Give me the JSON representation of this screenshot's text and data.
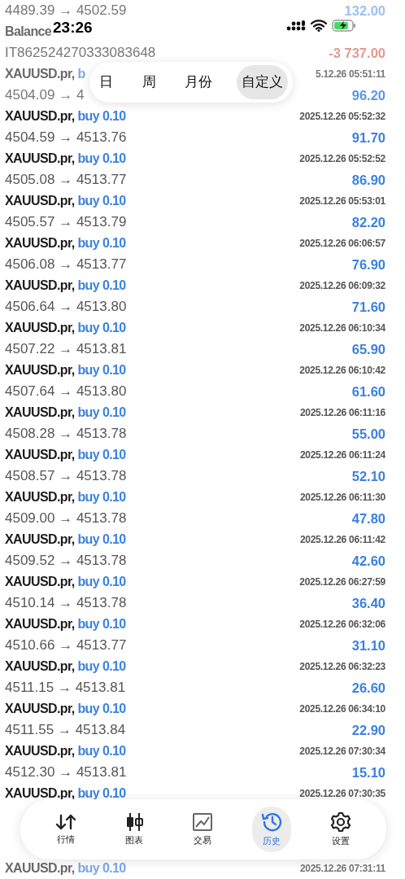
{
  "status_bar": {
    "time": "23:26"
  },
  "period_tabs": [
    {
      "label": "日",
      "selected": false
    },
    {
      "label": "周",
      "selected": false
    },
    {
      "label": "月份",
      "selected": false
    },
    {
      "label": "自定义",
      "selected": true
    }
  ],
  "deals": [
    {
      "faded": true,
      "price": "4489.39 → 4502.59",
      "profit": "132.00",
      "color": "#9dbff0"
    },
    {
      "faded": true,
      "symbol": "Balance",
      "comment": "IT862524270333083648",
      "profit": "-3 737.00",
      "color": "#e39a8c"
    },
    {
      "faded": true,
      "symbol": "XAUUSD.pr, ",
      "side": "b",
      "time": "5.12.26 05:51:11",
      "price": "4504.09 → 4",
      "profit": "96.20",
      "color": "#5b95e6"
    },
    {
      "faded": false,
      "symbol": "XAUUSD.pr, ",
      "side": "buy 0.10",
      "time": "2025.12.26 05:52:32",
      "price": "4504.59 → 4513.76",
      "profit": "91.70",
      "color": "#3a80e0"
    },
    {
      "faded": false,
      "symbol": "XAUUSD.pr, ",
      "side": "buy 0.10",
      "time": "2025.12.26 05:52:52",
      "price": "4505.08 → 4513.77",
      "profit": "86.90",
      "color": "#3a80e0"
    },
    {
      "faded": false,
      "symbol": "XAUUSD.pr, ",
      "side": "buy 0.10",
      "time": "2025.12.26 05:53:01",
      "price": "4505.57 → 4513.79",
      "profit": "82.20",
      "color": "#3a80e0"
    },
    {
      "faded": false,
      "symbol": "XAUUSD.pr, ",
      "side": "buy 0.10",
      "time": "2025.12.26 06:06:57",
      "price": "4506.08 → 4513.77",
      "profit": "76.90",
      "color": "#3a80e0"
    },
    {
      "faded": false,
      "symbol": "XAUUSD.pr, ",
      "side": "buy 0.10",
      "time": "2025.12.26 06:09:32",
      "price": "4506.64 → 4513.80",
      "profit": "71.60",
      "color": "#3a80e0"
    },
    {
      "faded": false,
      "symbol": "XAUUSD.pr, ",
      "side": "buy 0.10",
      "time": "2025.12.26 06:10:34",
      "price": "4507.22 → 4513.81",
      "profit": "65.90",
      "color": "#3a80e0"
    },
    {
      "faded": false,
      "symbol": "XAUUSD.pr, ",
      "side": "buy 0.10",
      "time": "2025.12.26 06:10:42",
      "price": "4507.64 → 4513.80",
      "profit": "61.60",
      "color": "#3a80e0"
    },
    {
      "faded": false,
      "symbol": "XAUUSD.pr, ",
      "side": "buy 0.10",
      "time": "2025.12.26 06:11:16",
      "price": "4508.28 → 4513.78",
      "profit": "55.00",
      "color": "#3a80e0"
    },
    {
      "faded": false,
      "symbol": "XAUUSD.pr, ",
      "side": "buy 0.10",
      "time": "2025.12.26 06:11:24",
      "price": "4508.57 → 4513.78",
      "profit": "52.10",
      "color": "#3a80e0"
    },
    {
      "faded": false,
      "symbol": "XAUUSD.pr, ",
      "side": "buy 0.10",
      "time": "2025.12.26 06:11:30",
      "price": "4509.00 → 4513.78",
      "profit": "47.80",
      "color": "#3a80e0"
    },
    {
      "faded": false,
      "symbol": "XAUUSD.pr, ",
      "side": "buy 0.10",
      "time": "2025.12.26 06:11:42",
      "price": "4509.52 → 4513.78",
      "profit": "42.60",
      "color": "#3a80e0"
    },
    {
      "faded": false,
      "symbol": "XAUUSD.pr, ",
      "side": "buy 0.10",
      "time": "2025.12.26 06:27:59",
      "price": "4510.14 → 4513.78",
      "profit": "36.40",
      "color": "#3a80e0"
    },
    {
      "faded": false,
      "symbol": "XAUUSD.pr, ",
      "side": "buy 0.10",
      "time": "2025.12.26 06:32:06",
      "price": "4510.66 → 4513.77",
      "profit": "31.10",
      "color": "#3a80e0"
    },
    {
      "faded": false,
      "symbol": "XAUUSD.pr, ",
      "side": "buy 0.10",
      "time": "2025.12.26 06:32:23",
      "price": "4511.15 → 4513.81",
      "profit": "26.60",
      "color": "#3a80e0"
    },
    {
      "faded": false,
      "symbol": "XAUUSD.pr, ",
      "side": "buy 0.10",
      "time": "2025.12.26 06:34:10",
      "price": "4511.55 → 4513.84",
      "profit": "22.90",
      "color": "#3a80e0"
    },
    {
      "faded": false,
      "symbol": "XAUUSD.pr, ",
      "side": "buy 0.10",
      "time": "2025.12.26 07:30:34",
      "price": "4512.30 → 4513.81",
      "profit": "15.10",
      "color": "#3a80e0"
    },
    {
      "faded": false,
      "symbol": "XAUUSD.pr, ",
      "side": "buy 0.10",
      "time": "2025.12.26 07:30:35"
    },
    {
      "faded": true,
      "symbol": "XAUUSD.pr, ",
      "side": "buy 0.10",
      "time": "2025.12.26 07:31:11"
    }
  ],
  "bottom_nav": [
    {
      "label": "行情",
      "kind": "quotes",
      "selected": false
    },
    {
      "label": "图表",
      "kind": "chart",
      "selected": false
    },
    {
      "label": "交易",
      "kind": "trade",
      "selected": false
    },
    {
      "label": "历史",
      "kind": "history",
      "selected": true
    },
    {
      "label": "设置",
      "kind": "settings",
      "selected": false
    }
  ]
}
